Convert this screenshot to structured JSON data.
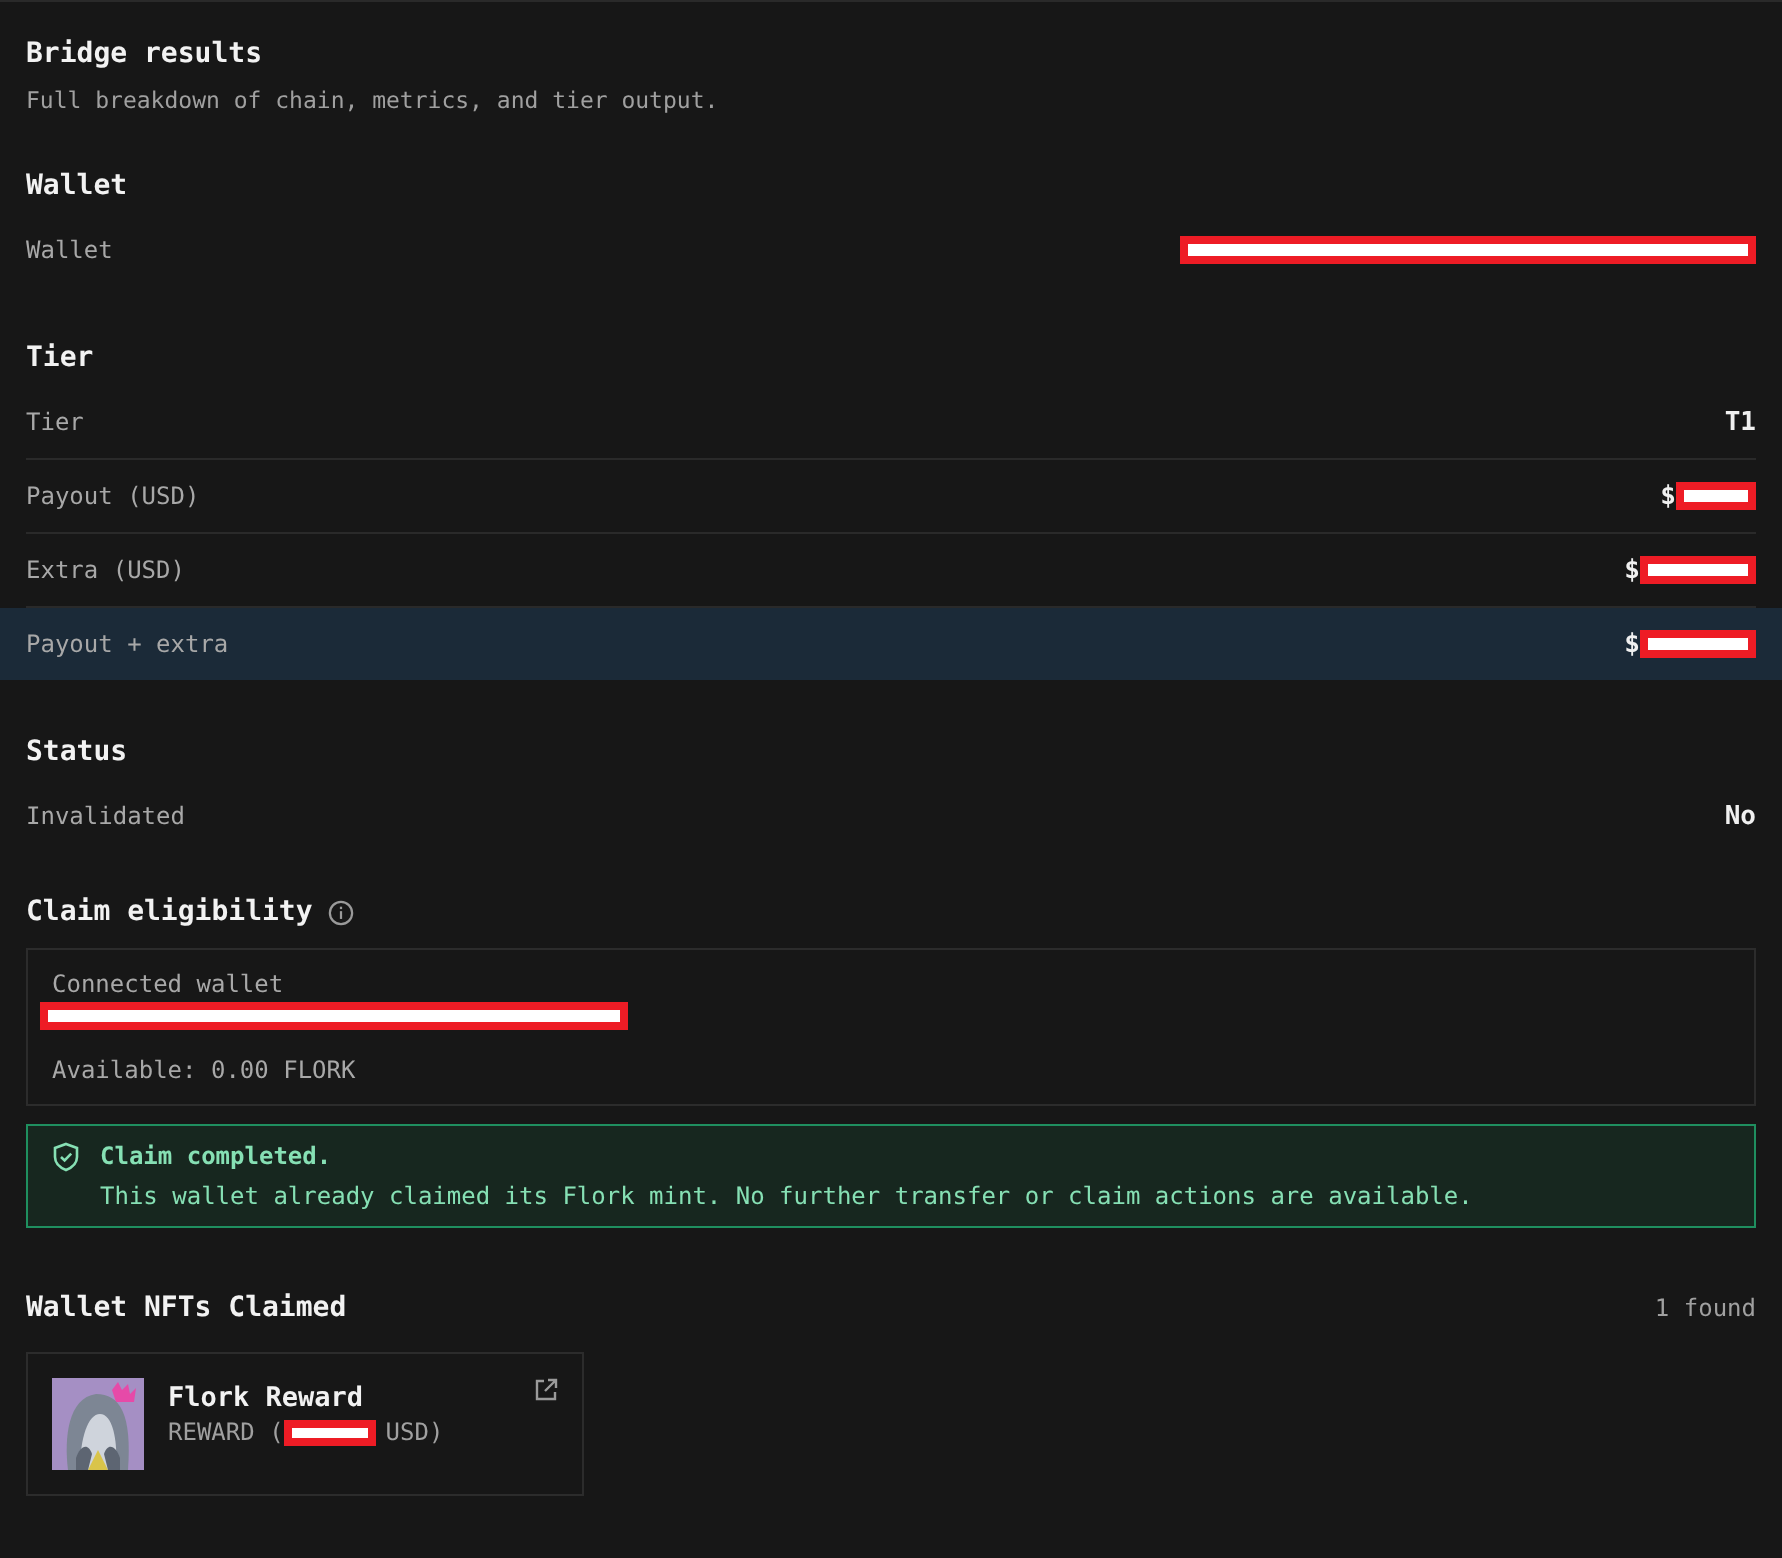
{
  "header": {
    "title": "Bridge results",
    "subtitle": "Full breakdown of chain, metrics, and tier output."
  },
  "sections": [
    {
      "title": "Wallet",
      "rows": [
        {
          "label": "Wallet",
          "value": "",
          "redacted": true,
          "highlighted": false
        }
      ]
    },
    {
      "title": "Tier",
      "rows": [
        {
          "label": "Tier",
          "value": "T1",
          "redacted": false,
          "highlighted": false
        },
        {
          "label": "Payout (USD)",
          "value": "$",
          "redacted": true,
          "highlighted": false
        },
        {
          "label": "Extra (USD)",
          "value": "$",
          "redacted": true,
          "highlighted": false
        },
        {
          "label": "Payout + extra",
          "value": "$",
          "redacted": true,
          "highlighted": true
        }
      ]
    },
    {
      "title": "Status",
      "rows": [
        {
          "label": "Invalidated",
          "value": "No",
          "redacted": false,
          "highlighted": false
        }
      ]
    }
  ],
  "claim": {
    "title": "Claim eligibility",
    "wallet_label": "Connected wallet",
    "wallet_redacted": true,
    "available": "Available: 0.00 FLORK",
    "alert": {
      "title": "Claim completed.",
      "message": "This wallet already claimed its Flork mint. No further transfer or claim actions are available."
    }
  },
  "nfts": {
    "title": "Wallet NFTs Claimed",
    "count": "1 found",
    "items": [
      {
        "name": "Flork Reward",
        "kind_label": "REWARD (",
        "value_redacted": true,
        "suffix": "USD)"
      }
    ]
  }
}
